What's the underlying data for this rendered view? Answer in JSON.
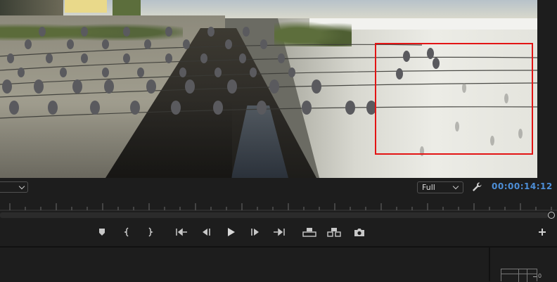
{
  "program_monitor": {
    "resolution": "Full",
    "timecode": "00:00:14:12",
    "crop_overlay_color": "#e31414",
    "timecode_color": "#4d8fd8"
  },
  "transport": {
    "buttons": [
      {
        "name": "add-marker",
        "icon": "marker-icon"
      },
      {
        "name": "mark-in",
        "icon": "mark-in-icon"
      },
      {
        "name": "mark-out",
        "icon": "mark-out-icon"
      },
      {
        "name": "go-to-in",
        "icon": "go-to-in-icon"
      },
      {
        "name": "step-back",
        "icon": "step-back-icon"
      },
      {
        "name": "play",
        "icon": "play-icon"
      },
      {
        "name": "step-forward",
        "icon": "step-forward-icon"
      },
      {
        "name": "go-to-out",
        "icon": "go-to-out-icon"
      },
      {
        "name": "lift",
        "icon": "lift-icon"
      },
      {
        "name": "extract",
        "icon": "extract-icon"
      },
      {
        "name": "export-frame",
        "icon": "camera-icon"
      },
      {
        "name": "button-editor",
        "icon": "plus-icon"
      }
    ]
  },
  "audio_meter": {
    "scale_label": "0"
  }
}
